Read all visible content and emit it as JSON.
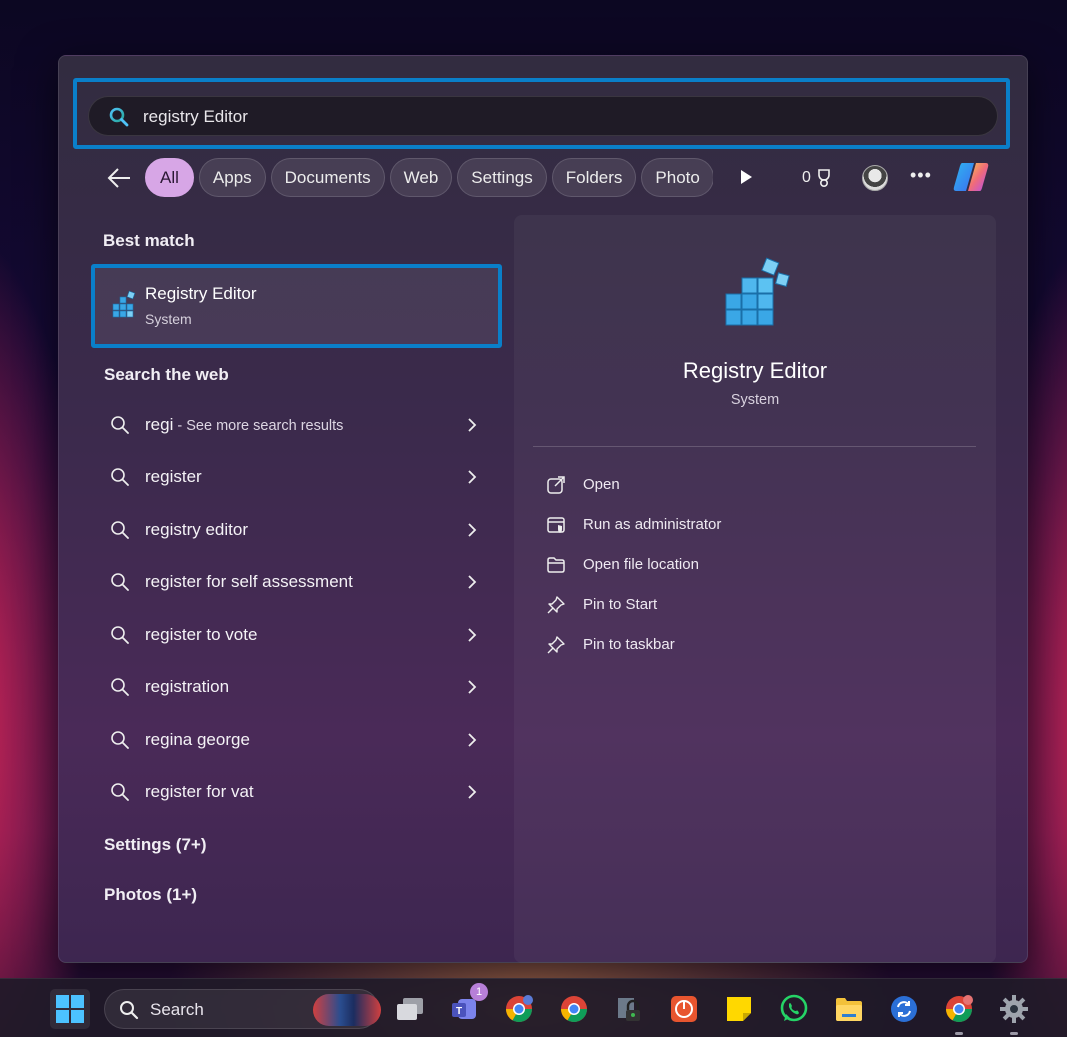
{
  "search": {
    "value": "registry Editor",
    "placeholder": ""
  },
  "filters": {
    "chips": [
      "All",
      "Apps",
      "Documents",
      "Web",
      "Settings",
      "Folders",
      "Photo"
    ],
    "points": "0"
  },
  "best_match": {
    "heading": "Best match",
    "title": "Registry Editor",
    "subtitle": "System"
  },
  "web": {
    "heading": "Search the web",
    "items": [
      {
        "query": "regi",
        "extra": " - See more search results"
      },
      {
        "query": "register",
        "extra": ""
      },
      {
        "query": "registry editor",
        "extra": ""
      },
      {
        "query": "register for self assessment",
        "extra": ""
      },
      {
        "query": "register to vote",
        "extra": ""
      },
      {
        "query": "registration",
        "extra": ""
      },
      {
        "query": "regina george",
        "extra": ""
      },
      {
        "query": "register for vat",
        "extra": ""
      }
    ]
  },
  "groups": {
    "settings": "Settings (7+)",
    "photos": "Photos (1+)"
  },
  "detail": {
    "title": "Registry Editor",
    "subtitle": "System",
    "actions": [
      "Open",
      "Run as administrator",
      "Open file location",
      "Pin to Start",
      "Pin to taskbar"
    ]
  },
  "taskbar": {
    "search_label": "Search",
    "teams_badge": "1",
    "icons": [
      "windows-start-icon",
      "task-view-icon",
      "teams-icon",
      "chrome-profile-icon",
      "chrome-icon",
      "lock-app-icon",
      "power-app-icon",
      "sticky-notes-icon",
      "whatsapp-icon",
      "file-explorer-icon",
      "sync-icon",
      "chrome-alt-icon",
      "settings-gear-icon"
    ]
  },
  "colors": {
    "highlight": "#0a7fc9",
    "active_chip": "#d7a6e6"
  }
}
